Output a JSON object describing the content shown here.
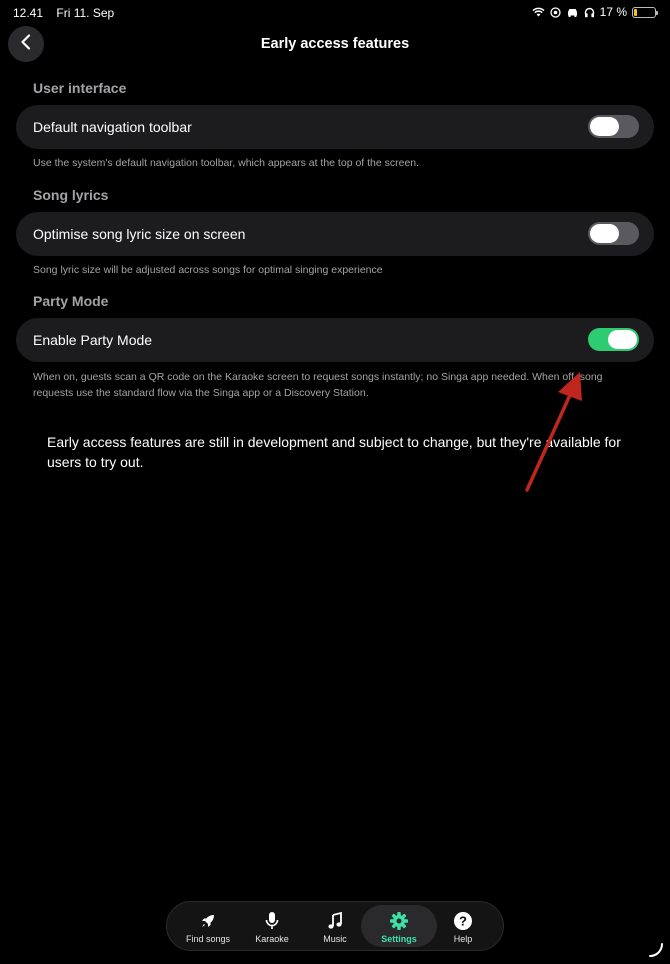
{
  "status": {
    "time": "12.41",
    "date": "Fri 11. Sep",
    "battery": "17 %",
    "battery_level": 0.17
  },
  "header": {
    "title": "Early access features"
  },
  "sections": [
    {
      "title": "User interface",
      "row_label": "Default navigation toolbar",
      "enabled": false,
      "description": "Use the system's default navigation toolbar, which appears at the top of the screen."
    },
    {
      "title": "Song lyrics",
      "row_label": "Optimise song lyric size on screen",
      "enabled": false,
      "description": "Song lyric size will be adjusted across songs for optimal singing experience"
    },
    {
      "title": "Party Mode",
      "row_label": "Enable Party Mode",
      "enabled": true,
      "description_line1": "When on, guests scan a QR code on the Karaoke screen to request songs instantly; no Singa app needed. When off, song",
      "description_line2": "requests use the standard flow via the Singa app or a Discovery Station."
    }
  ],
  "note": "Early access features are still in development and subject to change, but they're available for users to try out.",
  "tabs": [
    {
      "label": "Find songs",
      "icon": "rocket-icon"
    },
    {
      "label": "Karaoke",
      "icon": "microphone-icon"
    },
    {
      "label": "Music",
      "icon": "music-note-icon"
    },
    {
      "label": "Settings",
      "icon": "gear-icon",
      "active": true
    },
    {
      "label": "Help",
      "icon": "help-icon"
    }
  ],
  "colors": {
    "accent": "#3ee0a8",
    "toggle_on": "#2ecc71",
    "annotation_arrow": "#c0261d"
  }
}
